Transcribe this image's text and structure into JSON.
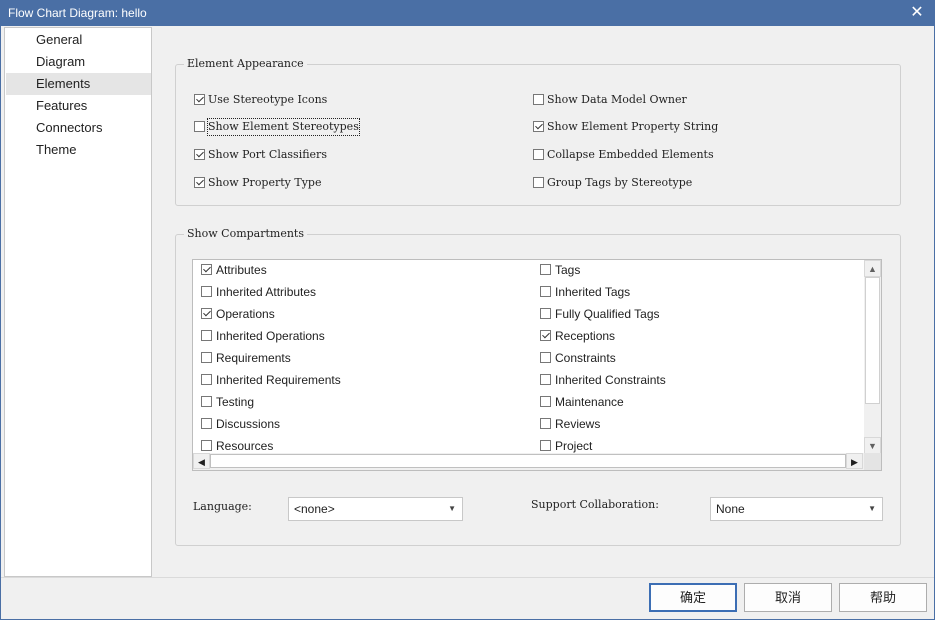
{
  "window": {
    "title": "Flow Chart Diagram: hello",
    "close_glyph": "✕"
  },
  "sidebar": {
    "items": [
      {
        "label": "General",
        "active": false
      },
      {
        "label": "Diagram",
        "active": false
      },
      {
        "label": "Elements",
        "active": true
      },
      {
        "label": "Features",
        "active": false
      },
      {
        "label": "Connectors",
        "active": false
      },
      {
        "label": "Theme",
        "active": false
      }
    ]
  },
  "appearance": {
    "title": "Element Appearance",
    "options": [
      {
        "label": "Use Stereotype Icons",
        "checked": true
      },
      {
        "label": "Show Element Stereotypes",
        "checked": false
      },
      {
        "label": "Show Port Classifiers",
        "checked": true
      },
      {
        "label": "Show Property Type",
        "checked": true
      },
      {
        "label": "Show Data Model Owner",
        "checked": false
      },
      {
        "label": "Show Element Property String",
        "checked": true
      },
      {
        "label": "Collapse Embedded Elements",
        "checked": false
      },
      {
        "label": "Group Tags by Stereotype",
        "checked": false
      }
    ]
  },
  "compartments": {
    "title": "Show Compartments",
    "left": [
      {
        "label": "Attributes",
        "checked": true
      },
      {
        "label": "Inherited Attributes",
        "checked": false
      },
      {
        "label": "Operations",
        "checked": true
      },
      {
        "label": "Inherited Operations",
        "checked": false
      },
      {
        "label": "Requirements",
        "checked": false
      },
      {
        "label": "Inherited Requirements",
        "checked": false
      },
      {
        "label": "Testing",
        "checked": false
      },
      {
        "label": "Discussions",
        "checked": false
      },
      {
        "label": "Resources",
        "checked": false
      }
    ],
    "right": [
      {
        "label": "Tags",
        "checked": false
      },
      {
        "label": "Inherited Tags",
        "checked": false
      },
      {
        "label": "Fully Qualified Tags",
        "checked": false
      },
      {
        "label": "Receptions",
        "checked": true
      },
      {
        "label": "Constraints",
        "checked": false
      },
      {
        "label": "Inherited Constraints",
        "checked": false
      },
      {
        "label": "Maintenance",
        "checked": false
      },
      {
        "label": "Reviews",
        "checked": false
      },
      {
        "label": "Project",
        "checked": false
      }
    ]
  },
  "language": {
    "label": "Language:",
    "value": "<none>"
  },
  "collaboration": {
    "label": "Support Collaboration:",
    "value": "None"
  },
  "footer": {
    "ok": "确定",
    "cancel": "取消",
    "help": "帮助"
  }
}
